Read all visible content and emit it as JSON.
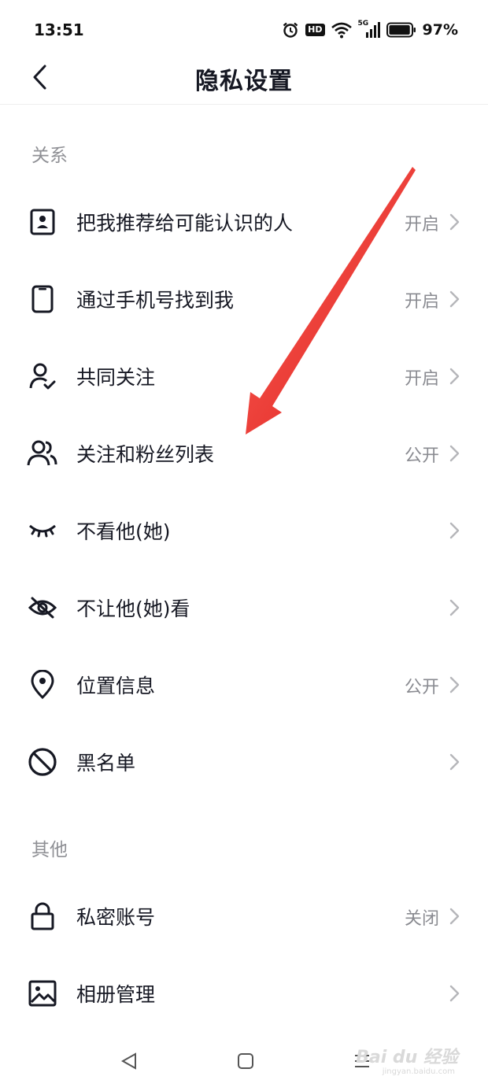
{
  "status_bar": {
    "time": "13:51",
    "hd_label": "HD",
    "network_label": "5G",
    "battery_percent": "97%",
    "battery_level": 0.97
  },
  "header": {
    "title": "隐私设置"
  },
  "sections": [
    {
      "title": "关系",
      "items": [
        {
          "label": "把我推荐给可能认识的人",
          "value": "开启",
          "icon": "contact-card-icon"
        },
        {
          "label": "通过手机号找到我",
          "value": "开启",
          "icon": "phone-icon"
        },
        {
          "label": "共同关注",
          "value": "开启",
          "icon": "user-check-icon"
        },
        {
          "label": "关注和粉丝列表",
          "value": "公开",
          "icon": "users-icon"
        },
        {
          "label": "不看他(她)",
          "value": "",
          "icon": "eye-closed-icon"
        },
        {
          "label": "不让他(她)看",
          "value": "",
          "icon": "eye-off-icon"
        },
        {
          "label": "位置信息",
          "value": "公开",
          "icon": "location-pin-icon"
        },
        {
          "label": "黑名单",
          "value": "",
          "icon": "block-icon"
        }
      ]
    },
    {
      "title": "其他",
      "items": [
        {
          "label": "私密账号",
          "value": "关闭",
          "icon": "lock-icon"
        },
        {
          "label": "相册管理",
          "value": "",
          "icon": "image-icon"
        }
      ]
    }
  ],
  "watermark": {
    "text": "Bai du 经验",
    "sub": "jingyan.baidu.com"
  },
  "colors": {
    "text_primary": "#161823",
    "text_secondary": "#8a8b91",
    "annotation_arrow": "#e8201f"
  }
}
